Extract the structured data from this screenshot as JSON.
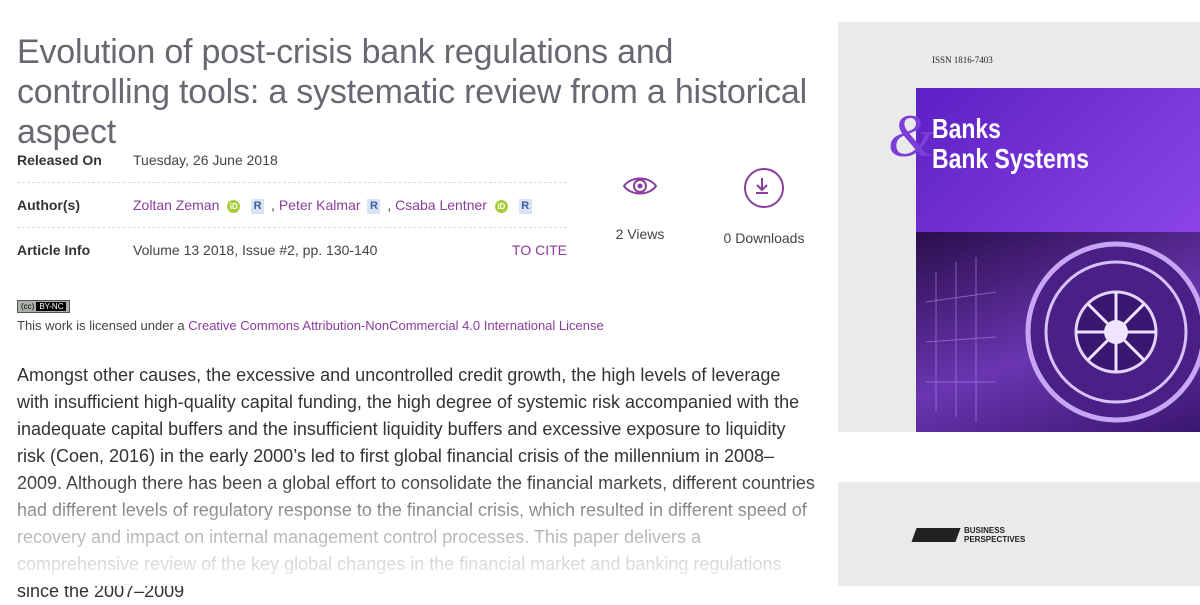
{
  "article": {
    "title": "Evolution of post-crisis bank regulations and controlling tools: a systematic review from a historical aspect"
  },
  "meta": {
    "released_label": "Released On",
    "released_value": "Tuesday, 26 June 2018",
    "authors_label": "Author(s)",
    "authors": [
      "Zoltan Zeman",
      "Peter Kalmar",
      "Csaba Lentner"
    ],
    "author_separator": ",",
    "info_label": "Article Info",
    "info_value": "Volume 13 2018, Issue #2, pp. 130-140",
    "cite_label": "TO CITE"
  },
  "icons": {
    "orcid": "iD",
    "researchgate": "R"
  },
  "stats": {
    "views": "2 Views",
    "downloads": "0 Downloads"
  },
  "license": {
    "badge_cc": "(cc)",
    "badge_text": "BY-NC",
    "prefix": "This work is licensed under a ",
    "link_text": "Creative Commons Attribution-NonCommercial 4.0 International License"
  },
  "abstract": {
    "text": "Amongst other causes, the excessive and uncontrolled credit growth, the high levels of leverage with insufficient high-quality capital funding, the high degree of systemic risk accompanied with the inadequate capital buffers and the insufficient liquidity buffers and excessive exposure to liquidity risk (Coen, 2016) in the early 2000’s led to first global financial crisis of the millennium in 2008–2009. Although there has been a global effort to consolidate the financial markets, different countries had different levels of regulatory response to the financial crisis, which resulted in different speed of recovery and impact on internal management control processes. This paper delivers a comprehensive review of the key global changes in the financial market and banking regulations since the 2007–2009"
  },
  "cover": {
    "issn": "ISSN 1816-7403",
    "amp": "&",
    "title_line1": "Banks",
    "title_line2": "Bank Systems",
    "publisher_line1": "BUSINESS",
    "publisher_line2": "PERSPECTIVES"
  },
  "colors": {
    "accent": "#8a3d9c",
    "cover_purple": "#6a2bd0"
  }
}
